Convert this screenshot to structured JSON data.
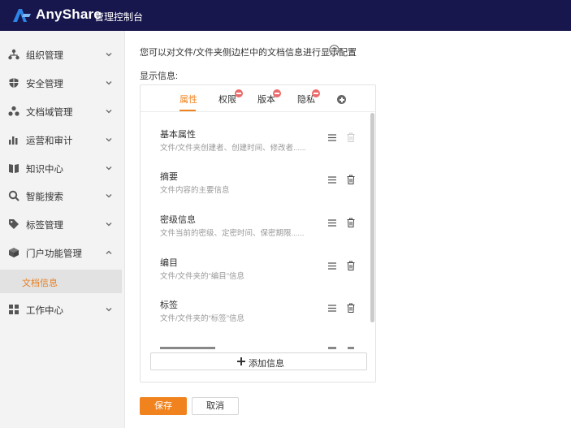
{
  "header": {
    "brand": "AnyShare",
    "console_title": "管理控制台"
  },
  "sidebar": {
    "items": [
      {
        "label": "组织管理",
        "icon": "org-icon",
        "expanded": false
      },
      {
        "label": "安全管理",
        "icon": "shield-icon",
        "expanded": false
      },
      {
        "label": "文档域管理",
        "icon": "doc-domain-icon",
        "expanded": false
      },
      {
        "label": "运营和审计",
        "icon": "bar-chart-icon",
        "expanded": false
      },
      {
        "label": "知识中心",
        "icon": "book-icon",
        "expanded": false
      },
      {
        "label": "智能搜索",
        "icon": "search-icon",
        "expanded": false
      },
      {
        "label": "标签管理",
        "icon": "tag-icon",
        "expanded": false
      },
      {
        "label": "门户功能管理",
        "icon": "cube-icon",
        "expanded": true
      },
      {
        "label": "工作中心",
        "icon": "grid-icon",
        "expanded": false
      }
    ],
    "active_sub_item": "文档信息"
  },
  "main": {
    "intro": "您可以对文件/文件夹侧边栏中的文档信息进行显示配置",
    "show_label": "显示信息:",
    "tabs": [
      {
        "label": "属性",
        "active": true,
        "removable": false
      },
      {
        "label": "权限",
        "active": false,
        "removable": true
      },
      {
        "label": "版本",
        "active": false,
        "removable": true
      },
      {
        "label": "隐私",
        "active": false,
        "removable": true
      }
    ],
    "items": [
      {
        "title": "基本属性",
        "desc": "文件/文件夹创建者、创建时间、修改者......",
        "deletable": false
      },
      {
        "title": "摘要",
        "desc": "文件内容的主要信息",
        "deletable": true
      },
      {
        "title": "密级信息",
        "desc": "文件当前的密级、定密时间、保密期限......",
        "deletable": true
      },
      {
        "title": "编目",
        "desc": "文件/文件夹的“编目”信息",
        "deletable": true
      },
      {
        "title": "标签",
        "desc": "文件/文件夹的“标签”信息",
        "deletable": true
      }
    ],
    "add_info_label": "添加信息",
    "save_label": "保存",
    "cancel_label": "取消"
  },
  "colors": {
    "header_bg": "#18174d",
    "accent": "#f0831e",
    "badge": "#ec6b6b",
    "sidebar_bg": "#f3f3f3",
    "logo_blue": "#2c86e8"
  }
}
